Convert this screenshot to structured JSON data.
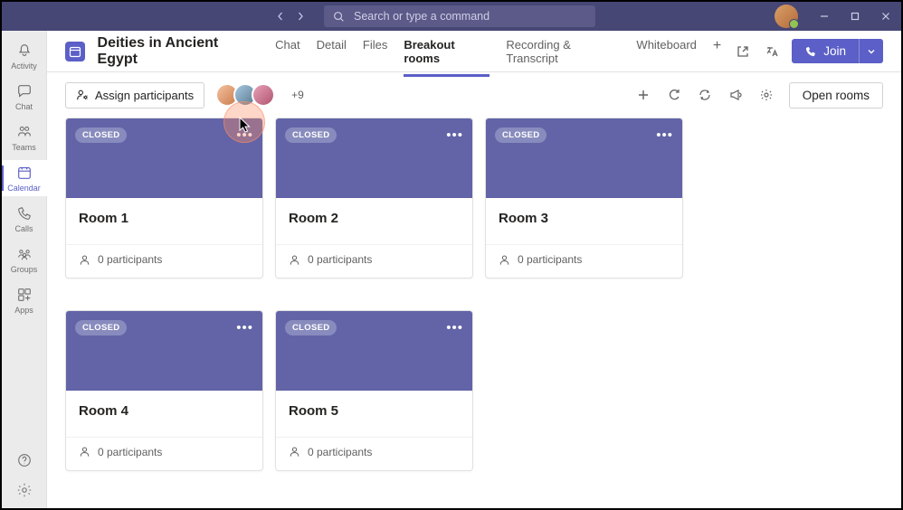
{
  "search": {
    "placeholder": "Search or type a command"
  },
  "rail": {
    "activity": "Activity",
    "chat": "Chat",
    "teams": "Teams",
    "calendar": "Calendar",
    "calls": "Calls",
    "groups": "Groups",
    "apps": "Apps"
  },
  "header": {
    "title": "Deities in Ancient Egypt",
    "tabs": {
      "chat": "Chat",
      "detail": "Detail",
      "files": "Files",
      "breakout": "Breakout rooms",
      "recording": "Recording & Transcript",
      "whiteboard": "Whiteboard"
    },
    "join": "Join"
  },
  "toolbar": {
    "assign": "Assign participants",
    "overflow": "+9",
    "open": "Open rooms"
  },
  "rooms": [
    {
      "status": "CLOSED",
      "name": "Room 1",
      "participants": "0 participants"
    },
    {
      "status": "CLOSED",
      "name": "Room 2",
      "participants": "0 participants"
    },
    {
      "status": "CLOSED",
      "name": "Room 3",
      "participants": "0 participants"
    },
    {
      "status": "CLOSED",
      "name": "Room 4",
      "participants": "0 participants"
    },
    {
      "status": "CLOSED",
      "name": "Room 5",
      "participants": "0 participants"
    }
  ]
}
